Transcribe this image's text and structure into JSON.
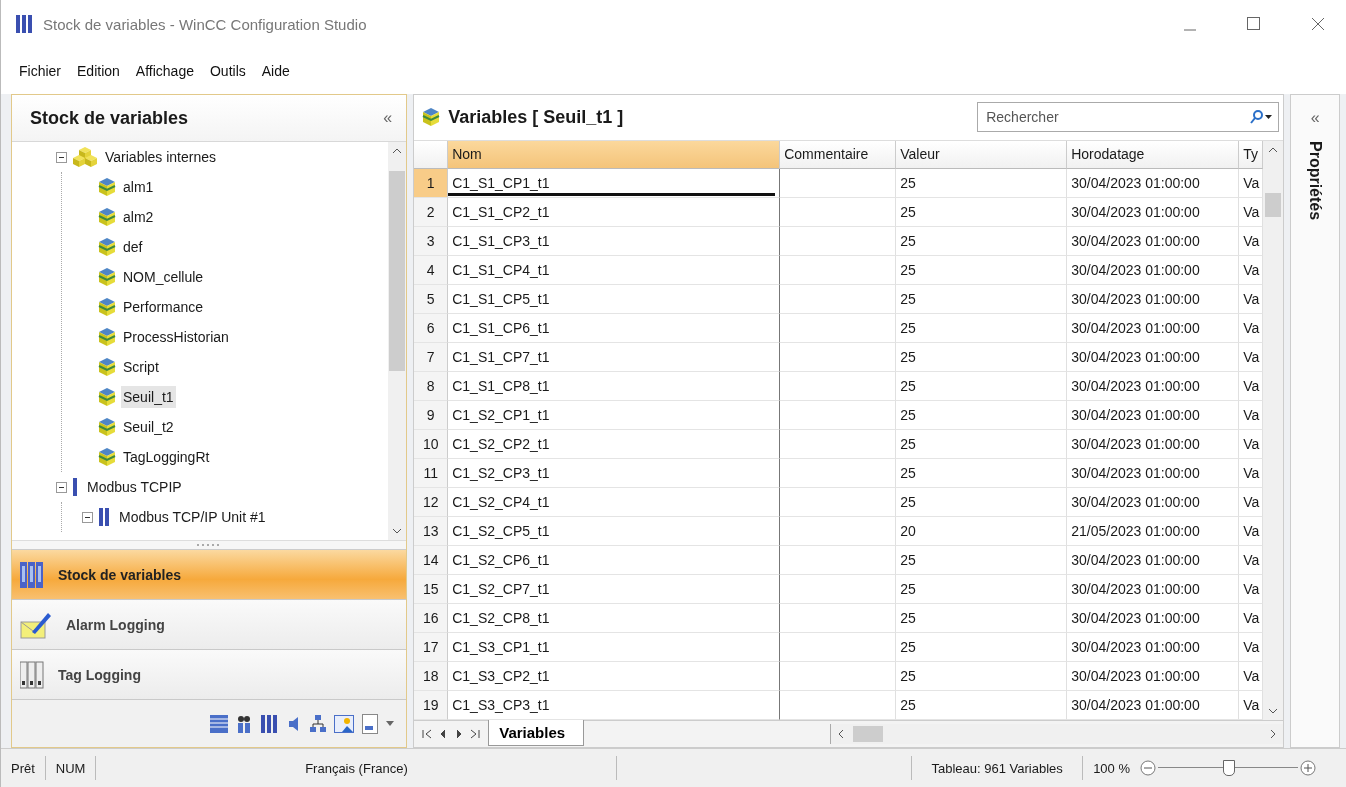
{
  "window": {
    "title": "Stock de variables - WinCC Configuration Studio"
  },
  "menu": [
    "Fichier",
    "Edition",
    "Affichage",
    "Outils",
    "Aide"
  ],
  "navigation": {
    "title": "Stock de variables",
    "collapse": "«",
    "tree": [
      {
        "label": "Variables internes",
        "kind": "group",
        "expanded": true,
        "selected": false,
        "children": [
          {
            "label": "alm1",
            "kind": "tag",
            "selected": false
          },
          {
            "label": "alm2",
            "kind": "tag",
            "selected": false
          },
          {
            "label": "def",
            "kind": "tag",
            "selected": false
          },
          {
            "label": "NOM_cellule",
            "kind": "tag",
            "selected": false
          },
          {
            "label": "Performance",
            "kind": "tag",
            "selected": false
          },
          {
            "label": "ProcessHistorian",
            "kind": "tag",
            "selected": false
          },
          {
            "label": "Script",
            "kind": "tag",
            "selected": false
          },
          {
            "label": "Seuil_t1",
            "kind": "tag",
            "selected": true
          },
          {
            "label": "Seuil_t2",
            "kind": "tag",
            "selected": false
          },
          {
            "label": "TagLoggingRt",
            "kind": "tag",
            "selected": false
          }
        ]
      },
      {
        "label": "Modbus TCPIP",
        "kind": "driver",
        "expanded": true,
        "selected": false,
        "children": [
          {
            "label": "Modbus TCP/IP Unit #1",
            "kind": "unit",
            "expanded": true,
            "selected": false
          }
        ]
      }
    ],
    "editors": [
      {
        "label": "Stock de variables",
        "kind": "tags",
        "selected": true
      },
      {
        "label": "Alarm Logging",
        "kind": "alarms",
        "selected": false
      },
      {
        "label": "Tag Logging",
        "kind": "logging",
        "selected": false
      }
    ]
  },
  "table": {
    "title": "Variables [ Seuil_t1 ]",
    "search": {
      "placeholder": "Rechercher"
    },
    "columns": [
      {
        "label": "Nom",
        "selected": true
      },
      {
        "label": "Commentaire",
        "selected": false
      },
      {
        "label": "Valeur",
        "selected": false
      },
      {
        "label": "Horodatage",
        "selected": false
      },
      {
        "label": "Ty",
        "selected": false
      }
    ],
    "rows": [
      {
        "number": "1",
        "nom": "C1_S1_CP1_t1",
        "valeur": "25",
        "horodatage": "30/04/2023 01:00:00",
        "column_5": "Va",
        "selected": true
      },
      {
        "number": "2",
        "nom": "C1_S1_CP2_t1",
        "valeur": "25",
        "horodatage": "30/04/2023 01:00:00",
        "column_5": "Va",
        "selected": false
      },
      {
        "number": "3",
        "nom": "C1_S1_CP3_t1",
        "valeur": "25",
        "horodatage": "30/04/2023 01:00:00",
        "column_5": "Va",
        "selected": false
      },
      {
        "number": "4",
        "nom": "C1_S1_CP4_t1",
        "valeur": "25",
        "horodatage": "30/04/2023 01:00:00",
        "column_5": "Va",
        "selected": false
      },
      {
        "number": "5",
        "nom": "C1_S1_CP5_t1",
        "valeur": "25",
        "horodatage": "30/04/2023 01:00:00",
        "column_5": "Va",
        "selected": false
      },
      {
        "number": "6",
        "nom": "C1_S1_CP6_t1",
        "valeur": "25",
        "horodatage": "30/04/2023 01:00:00",
        "column_5": "Va",
        "selected": false
      },
      {
        "number": "7",
        "nom": "C1_S1_CP7_t1",
        "valeur": "25",
        "horodatage": "30/04/2023 01:00:00",
        "column_5": "Va",
        "selected": false
      },
      {
        "number": "8",
        "nom": "C1_S1_CP8_t1",
        "valeur": "25",
        "horodatage": "30/04/2023 01:00:00",
        "column_5": "Va",
        "selected": false
      },
      {
        "number": "9",
        "nom": "C1_S2_CP1_t1",
        "valeur": "25",
        "horodatage": "30/04/2023 01:00:00",
        "column_5": "Va",
        "selected": false
      },
      {
        "number": "10",
        "nom": "C1_S2_CP2_t1",
        "valeur": "25",
        "horodatage": "30/04/2023 01:00:00",
        "column_5": "Va",
        "selected": false
      },
      {
        "number": "11",
        "nom": "C1_S2_CP3_t1",
        "valeur": "25",
        "horodatage": "30/04/2023 01:00:00",
        "column_5": "Va",
        "selected": false
      },
      {
        "number": "12",
        "nom": "C1_S2_CP4_t1",
        "valeur": "25",
        "horodatage": "30/04/2023 01:00:00",
        "column_5": "Va",
        "selected": false
      },
      {
        "number": "13",
        "nom": "C1_S2_CP5_t1",
        "valeur": "20",
        "horodatage": "21/05/2023 01:00:00",
        "column_5": "Va",
        "selected": false
      },
      {
        "number": "14",
        "nom": "C1_S2_CP6_t1",
        "valeur": "25",
        "horodatage": "30/04/2023 01:00:00",
        "column_5": "Va",
        "selected": false
      },
      {
        "number": "15",
        "nom": "C1_S2_CP7_t1",
        "valeur": "25",
        "horodatage": "30/04/2023 01:00:00",
        "column_5": "Va",
        "selected": false
      },
      {
        "number": "16",
        "nom": "C1_S2_CP8_t1",
        "valeur": "25",
        "horodatage": "30/04/2023 01:00:00",
        "column_5": "Va",
        "selected": false
      },
      {
        "number": "17",
        "nom": "C1_S3_CP1_t1",
        "valeur": "25",
        "horodatage": "30/04/2023 01:00:00",
        "column_5": "Va",
        "selected": false
      },
      {
        "number": "18",
        "nom": "C1_S3_CP2_t1",
        "valeur": "25",
        "horodatage": "30/04/2023 01:00:00",
        "column_5": "Va",
        "selected": false
      },
      {
        "number": "19",
        "nom": "C1_S3_CP3_t1",
        "valeur": "25",
        "horodatage": "30/04/2023 01:00:00",
        "column_5": "Va",
        "selected": false
      }
    ],
    "sheets": [
      {
        "label": "Variables",
        "selected": true
      }
    ]
  },
  "properties": {
    "title": "Propriétés",
    "collapse": "«"
  },
  "status_bar": {
    "state": "Prêt",
    "num": "NUM",
    "language": "Français (France)",
    "count": "Tableau: 961 Variables",
    "zoom": "100 %",
    "zoom_slider": {
      "level": 0.5
    }
  }
}
